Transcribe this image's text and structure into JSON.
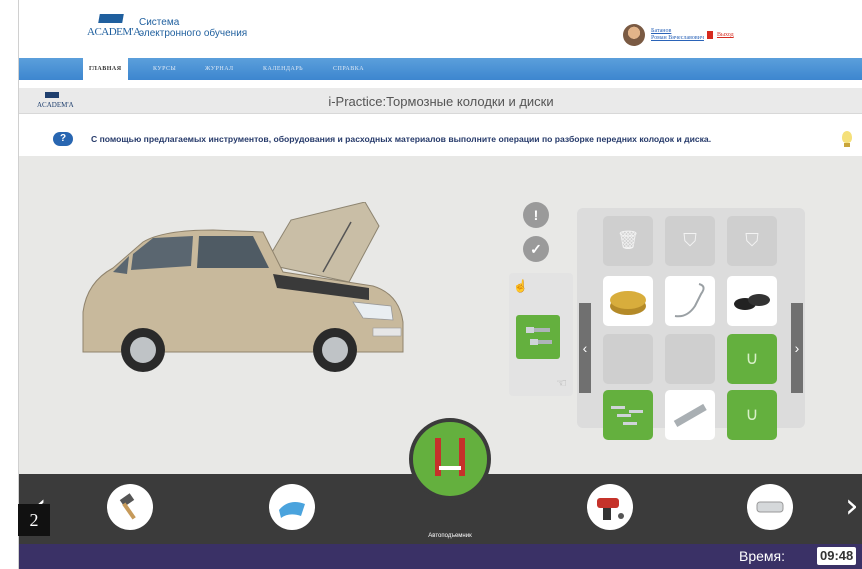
{
  "header": {
    "logo_word": "ACADEM'A",
    "logo_line1": "Система",
    "logo_line2": "электронного обучения",
    "user_line1": "Батанов",
    "user_line2": "Роман Вячеславович",
    "logout": "Выход"
  },
  "nav": {
    "items": [
      {
        "label": "ГЛАВНАЯ"
      },
      {
        "label": "КУРСЫ"
      },
      {
        "label": "ЖУРНАЛ"
      },
      {
        "label": "КАЛЕНДАРЬ"
      },
      {
        "label": "СПРАВКА"
      }
    ]
  },
  "titlebar": {
    "logo_word": "ACADEM'A",
    "title": "i-Practice:Тормозные колодки и диски"
  },
  "instruction": {
    "icon": "?",
    "text": "С помощью предлагаемых инструментов, оборудования и расходных материалов  выполните операции по разборке передних колодок и диска."
  },
  "controls": {
    "alert_icon": "!",
    "check_icon": "✓"
  },
  "inventory": {
    "left_arrow": "‹",
    "right_arrow": "›"
  },
  "toolbar": {
    "prev": "‹",
    "next": "›",
    "lift_label": "Автоподъемник"
  },
  "status": {
    "time_label": "Время:",
    "time_value": "09:48"
  },
  "page_number": "2",
  "colors": {
    "accent_green": "#64b03e",
    "nav_blue": "#3d86cf",
    "status_bar": "#3a3166"
  }
}
